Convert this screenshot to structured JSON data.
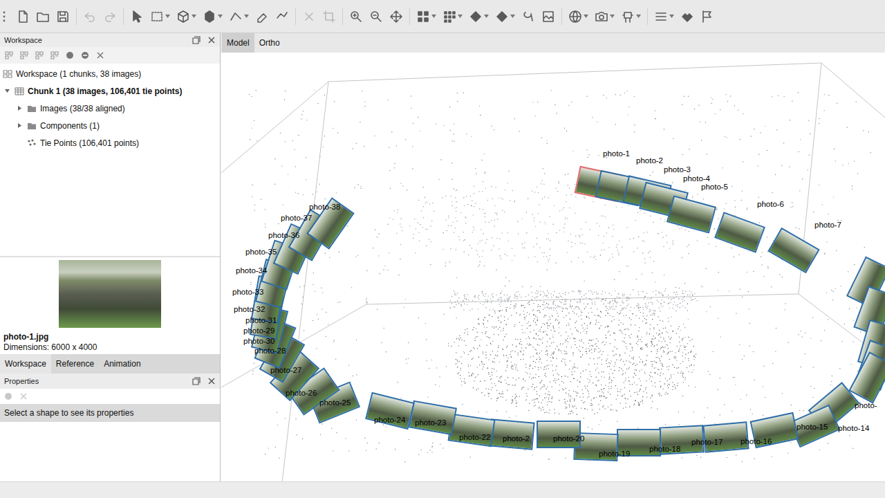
{
  "toolbar": {
    "undo": {
      "disabled": true
    },
    "redo": {
      "disabled": true
    },
    "delete": {
      "disabled": true
    },
    "crop": {
      "disabled": true
    }
  },
  "workspace_panel": {
    "title": "Workspace",
    "tree": [
      {
        "label": "Workspace (1 chunks, 38 images)",
        "kind": "workspace",
        "depth": 0,
        "expandable": false,
        "expanded": false,
        "bold": false
      },
      {
        "label": "Chunk 1 (38 images, 106,401 tie points)",
        "kind": "chunk",
        "depth": 0,
        "expandable": true,
        "expanded": true,
        "bold": true
      },
      {
        "label": "Images (38/38 aligned)",
        "kind": "folder",
        "depth": 1,
        "expandable": true,
        "expanded": false,
        "bold": false
      },
      {
        "label": "Components (1)",
        "kind": "folder",
        "depth": 1,
        "expandable": true,
        "expanded": false,
        "bold": false
      },
      {
        "label": "Tie Points (106,401 points)",
        "kind": "points",
        "depth": 1,
        "expandable": false,
        "expanded": false,
        "bold": false
      }
    ]
  },
  "preview": {
    "filename": "photo-1.jpg",
    "dimensions": "Dimensions: 6000 x 4000"
  },
  "bottom_tabs": [
    {
      "label": "Workspace",
      "selected": true
    },
    {
      "label": "Reference",
      "selected": false
    },
    {
      "label": "Animation",
      "selected": false
    }
  ],
  "properties_panel": {
    "title": "Properties",
    "message": "Select a shape to see its properties"
  },
  "view_tabs": [
    {
      "label": "Model",
      "selected": true
    },
    {
      "label": "Ortho",
      "selected": false
    }
  ],
  "cameras": [
    {
      "label": "photo-1",
      "selected": true
    },
    {
      "label": "photo-2",
      "selected": false
    },
    {
      "label": "photo-3",
      "selected": false
    },
    {
      "label": "photo-4",
      "selected": false
    },
    {
      "label": "photo-5",
      "selected": false
    },
    {
      "label": "photo-6",
      "selected": false
    },
    {
      "label": "photo-7",
      "selected": false
    },
    {
      "label": "photo-",
      "selected": false
    },
    {
      "label": "photo-14",
      "selected": false
    },
    {
      "label": "photo-15",
      "selected": false
    },
    {
      "label": "photo-16",
      "selected": false
    },
    {
      "label": "photo-17",
      "selected": false
    },
    {
      "label": "photo-18",
      "selected": false
    },
    {
      "label": "photo-19",
      "selected": false
    },
    {
      "label": "photo-20",
      "selected": false
    },
    {
      "label": "photo-2",
      "selected": false
    },
    {
      "label": "photo-22",
      "selected": false
    },
    {
      "label": "photo-23",
      "selected": false
    },
    {
      "label": "photo-24",
      "selected": false
    },
    {
      "label": "photo-25",
      "selected": false
    },
    {
      "label": "photo-26",
      "selected": false
    },
    {
      "label": "photo-27",
      "selected": false
    },
    {
      "label": "photo-28",
      "selected": false
    },
    {
      "label": "photo-29",
      "selected": false
    },
    {
      "label": "photo-30",
      "selected": false
    },
    {
      "label": "photo-31",
      "selected": false
    },
    {
      "label": "photo-32",
      "selected": false
    },
    {
      "label": "photo-33",
      "selected": false
    },
    {
      "label": "photo-34",
      "selected": false
    },
    {
      "label": "photo-35",
      "selected": false
    },
    {
      "label": "photo-36",
      "selected": false
    },
    {
      "label": "photo-37",
      "selected": false
    },
    {
      "label": "photo-38",
      "selected": false
    }
  ]
}
